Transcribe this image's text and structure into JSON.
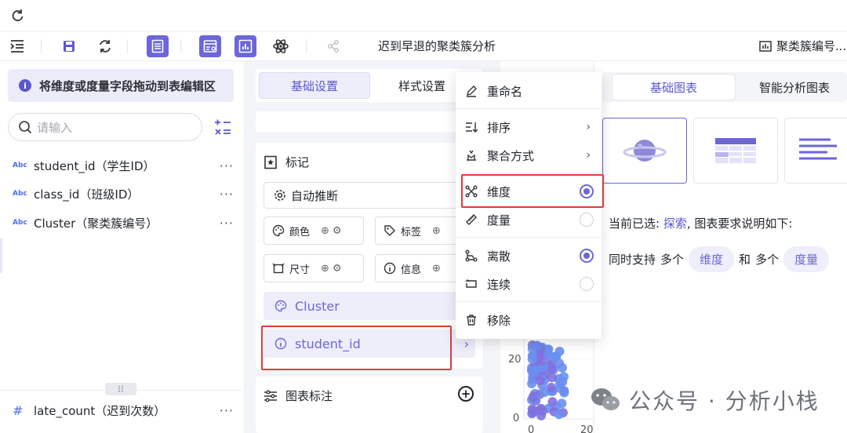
{
  "doc_title": "迟到早退的聚类簇分析",
  "right_title": "聚类簇编号...",
  "left": {
    "hint": "将维度或度量字段拖动到表编辑区",
    "search_placeholder": "请输入",
    "fields": [
      {
        "type": "Abc",
        "label": "student_id（学生ID）"
      },
      {
        "type": "Abc",
        "label": "class_id（班级ID）"
      },
      {
        "type": "Abc",
        "label": "Cluster（聚类簇编号）"
      }
    ],
    "measure_field": {
      "type": "#",
      "label": "late_count（迟到次数）"
    },
    "more": "···"
  },
  "mid": {
    "tab_basic": "基础设置",
    "tab_style": "样式设置",
    "mark_title": "标记",
    "auto_infer": "自动推断",
    "chip_color": "颜色",
    "chip_tag": "标签",
    "chip_size": "尺寸",
    "chip_info": "信息",
    "pill_cluster": "Cluster",
    "pill_student": "student_id",
    "annot_title": "图表标注"
  },
  "chart": {
    "y_tick_20": "20",
    "y_tick_0": "0",
    "x_tick_0": "0",
    "x_tick_20": "20"
  },
  "right": {
    "tab_basic_chart": "基础图表",
    "tab_smart": "智能分析图表",
    "desc_prefix": "当前已选:",
    "desc_link": "探索",
    "desc_suffix": ", 图表要求说明如下:",
    "desc2_a": "同时支持",
    "desc2_b": "多个",
    "tag_dim": "维度",
    "desc2_c": "和",
    "desc2_d": "多个",
    "tag_measure": "度量"
  },
  "menu": {
    "rename": "重命名",
    "sort": "排序",
    "aggregate": "聚合方式",
    "dimension": "维度",
    "measure": "度量",
    "discrete": "离散",
    "continuous": "连续",
    "remove": "移除",
    "arrow": "›"
  },
  "watermark": "公众号 · 分析小栈",
  "colors": {
    "accent": "#6b66d9",
    "highlight": "#e03b3b"
  }
}
